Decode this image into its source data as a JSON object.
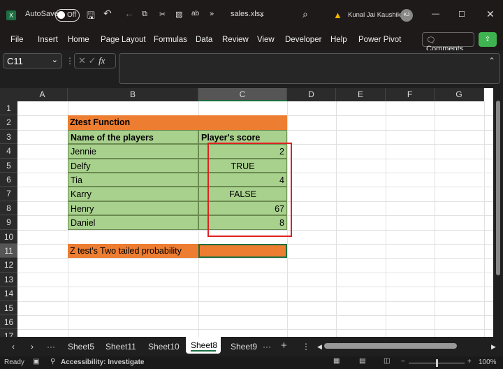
{
  "titlebar": {
    "app_icon": "excel-icon",
    "autosave_label": "AutoSave",
    "autosave_state": "Off",
    "filename": "sales.xlsx",
    "user": "Kunal Jai Kaushik",
    "initials": "KJ"
  },
  "ribbon": {
    "tabs": [
      "File",
      "Insert",
      "Home",
      "Page Layout",
      "Formulas",
      "Data",
      "Review",
      "View",
      "Developer",
      "Help",
      "Power Pivot"
    ],
    "comments": "Comments",
    "share_color": "#3fb34f"
  },
  "formula_bar": {
    "name_box": "C11",
    "formula": "",
    "fx": "fx"
  },
  "columns": [
    "A",
    "B",
    "C",
    "D",
    "E",
    "F",
    "G"
  ],
  "rows": [
    "1",
    "2",
    "3",
    "4",
    "5",
    "6",
    "7",
    "8",
    "9",
    "10",
    "11",
    "12",
    "13",
    "14",
    "15",
    "16",
    "17"
  ],
  "sheet": {
    "title": "Ztest Function",
    "headers": [
      "Name of the players",
      "Player's score"
    ],
    "data": [
      [
        "Jennie",
        "2"
      ],
      [
        "Delfy",
        "TRUE"
      ],
      [
        "Tia",
        "4"
      ],
      [
        "Karry",
        "FALSE"
      ],
      [
        "Henry",
        "67"
      ],
      [
        "Daniel",
        "8"
      ]
    ],
    "result_label": "Z test's Two tailed probability",
    "result_value": "",
    "colors": {
      "orange": "#ed7d31",
      "green": "#a9d18e",
      "highlight": "#e02020"
    }
  },
  "sheet_tabs": {
    "tabs": [
      "Sheet5",
      "Sheet11",
      "Sheet10",
      "Sheet8",
      "Sheet9"
    ],
    "active": "Sheet8"
  },
  "status": {
    "ready": "Ready",
    "accessibility": "Accessibility: Investigate",
    "zoom": "100%",
    "zoom_fraction": 0.5
  }
}
